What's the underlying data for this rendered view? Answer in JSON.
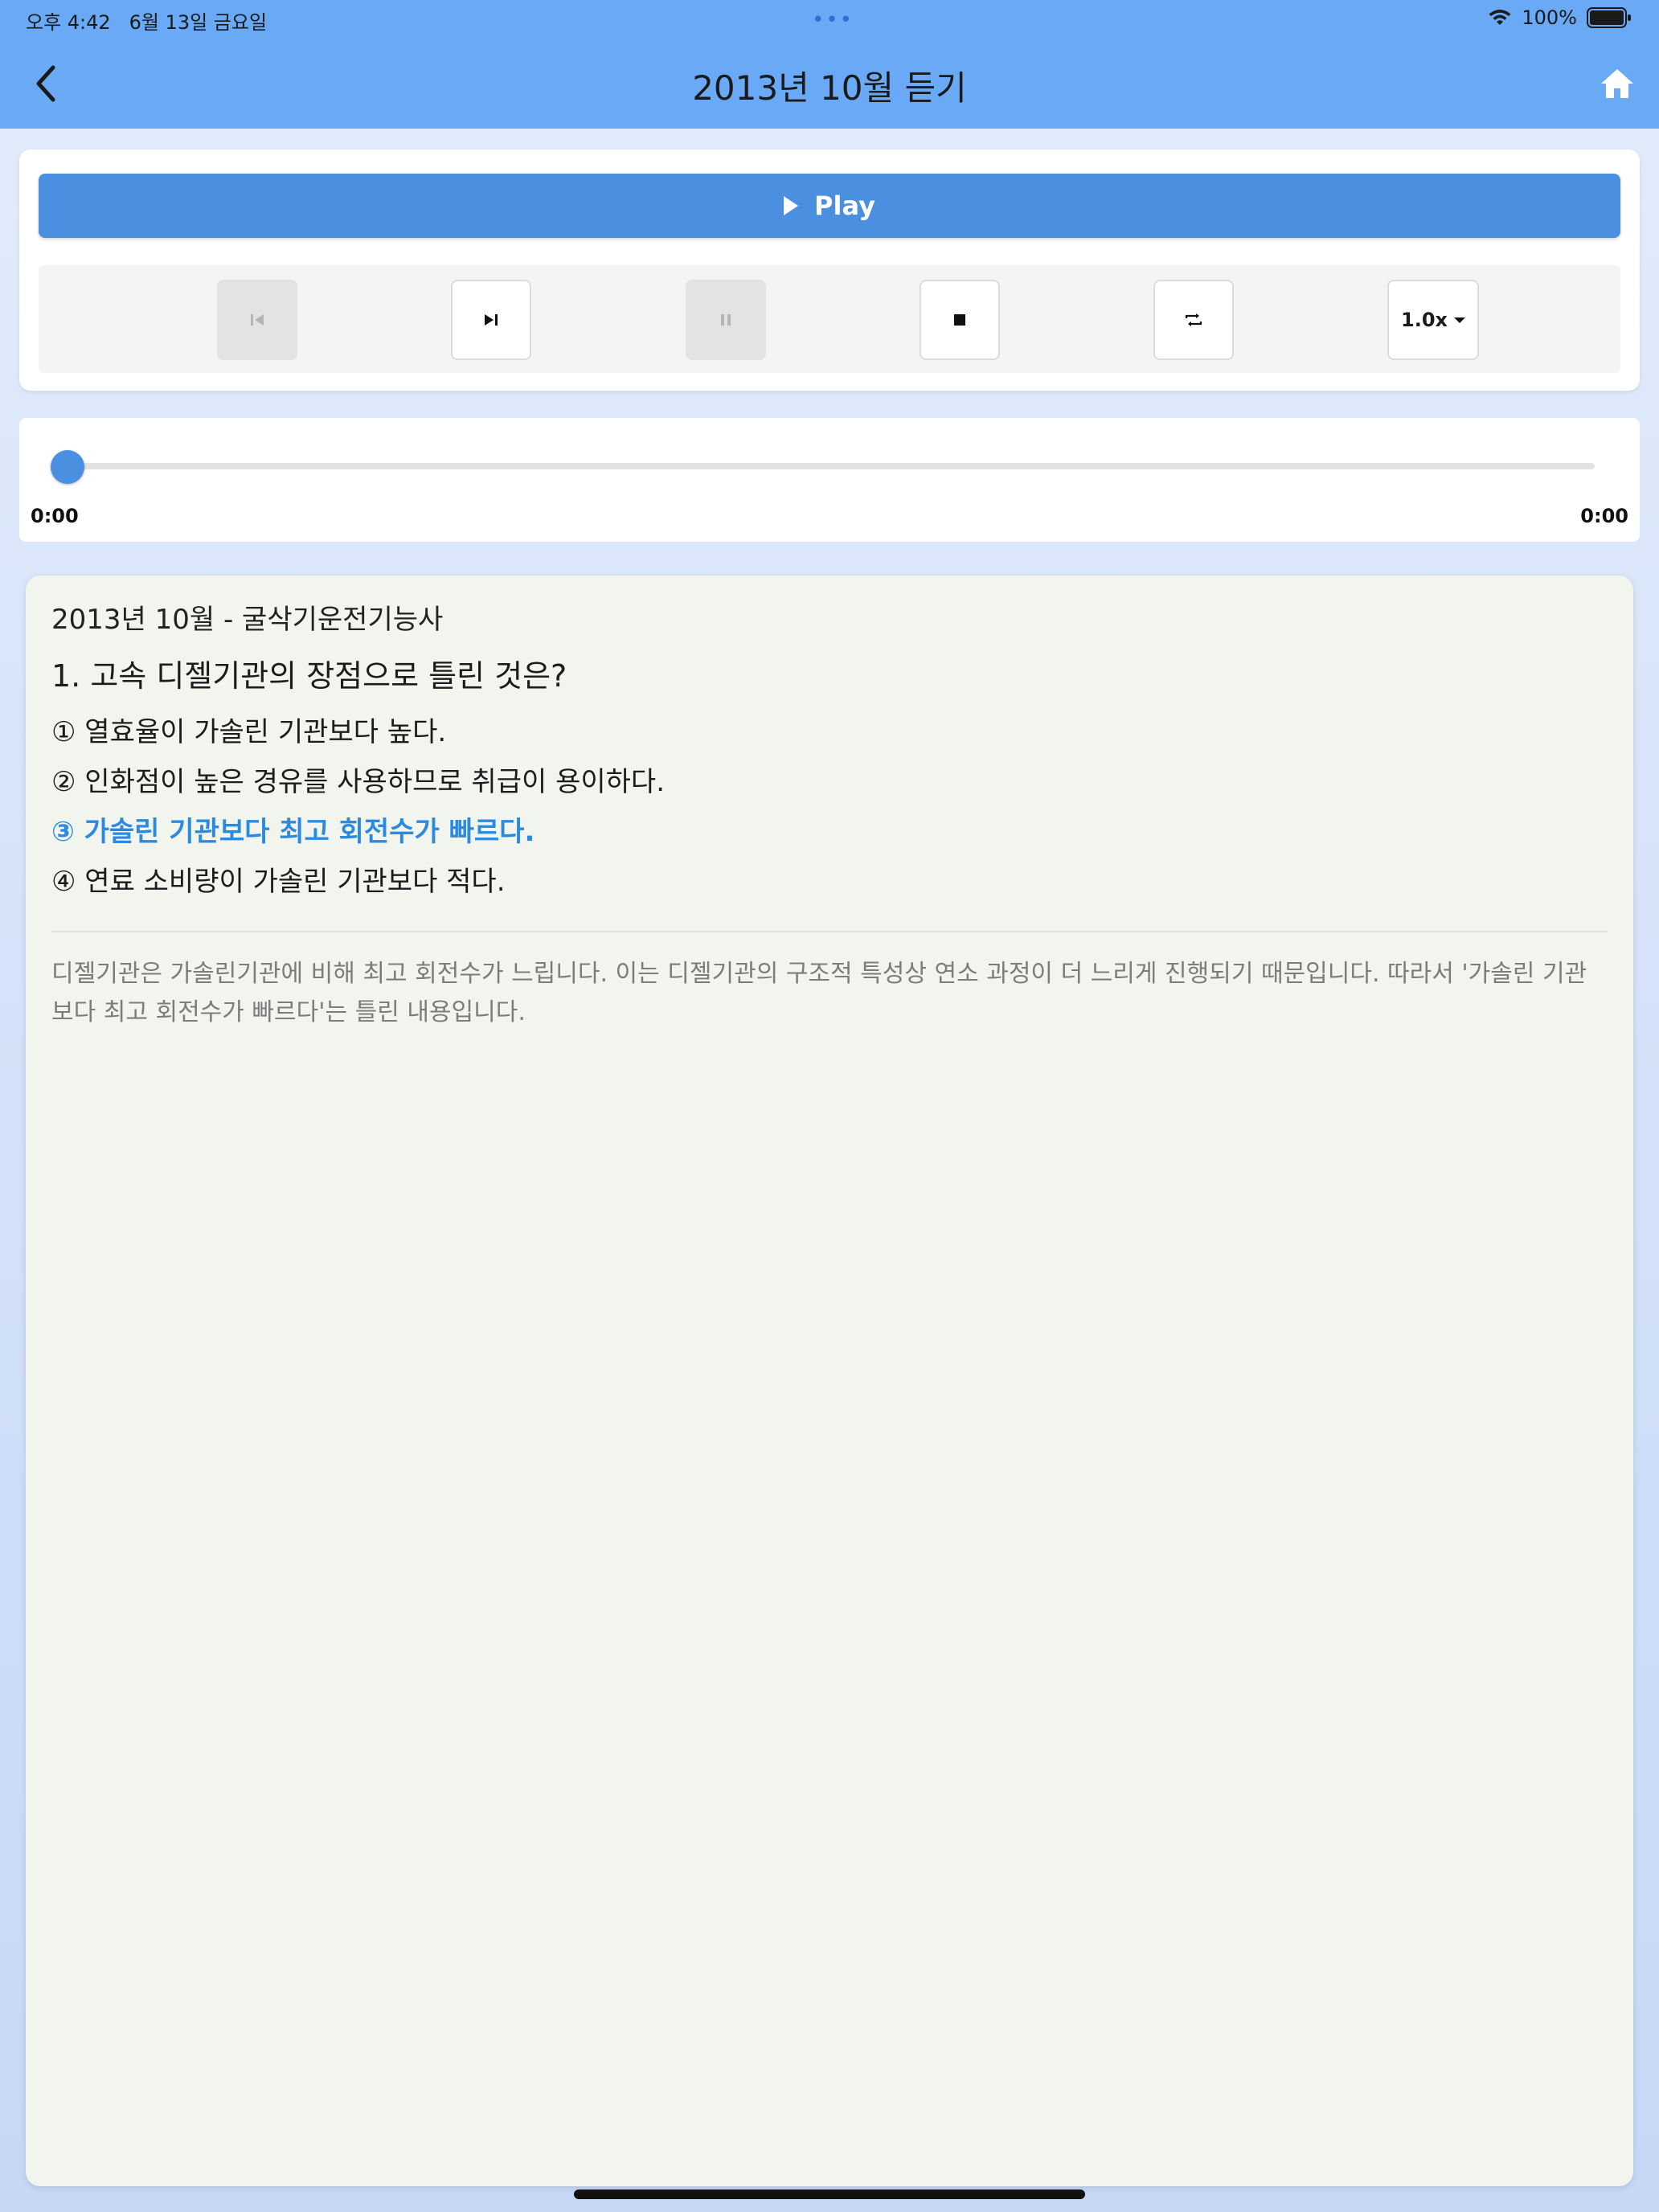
{
  "status_bar": {
    "time": "오후 4:42",
    "date": "6월 13일 금요일",
    "dots": "•••",
    "battery": "100%",
    "icons": [
      "wifi-icon",
      "battery-icon"
    ]
  },
  "nav": {
    "title": "2013년 10월 듣기",
    "back_icon": "chevron-left-icon",
    "home_icon": "home-icon"
  },
  "player": {
    "play_label": "Play",
    "speed_label": "1.0x",
    "controls": [
      {
        "name": "skip-previous-button",
        "icon": "skip-previous-icon",
        "enabled": false
      },
      {
        "name": "skip-next-button",
        "icon": "skip-next-icon",
        "enabled": true
      },
      {
        "name": "pause-button",
        "icon": "pause-icon",
        "enabled": false
      },
      {
        "name": "stop-button",
        "icon": "stop-icon",
        "enabled": true
      },
      {
        "name": "repeat-button",
        "icon": "repeat-icon",
        "enabled": true
      }
    ],
    "accent_color": "#4a8fe0"
  },
  "progress": {
    "current_time": "0:00",
    "total_time": "0:00",
    "position_fraction": 0
  },
  "question": {
    "exam_title": "2013년 10월 - 굴삭기운전기능사",
    "text": "1. 고속 디젤기관의 장점으로 틀린 것은?",
    "options": [
      {
        "label": "① 열효율이 가솔린 기관보다 높다.",
        "correct": false
      },
      {
        "label": "② 인화점이 높은 경유를 사용하므로 취급이 용이하다.",
        "correct": false
      },
      {
        "label": "③ 가솔린 기관보다 최고 회전수가 빠르다.",
        "correct": true
      },
      {
        "label": "④ 연료 소비량이 가솔린 기관보다 적다.",
        "correct": false
      }
    ],
    "correct_color": "#2b8ae0",
    "explanation": "디젤기관은 가솔린기관에 비해 최고 회전수가 느립니다. 이는 디젤기관의 구조적 특성상 연소 과정이 더 느리게 진행되기 때문입니다. 따라서 '가솔린 기관보다 최고 회전수가 빠르다'는 틀린 내용입니다."
  }
}
